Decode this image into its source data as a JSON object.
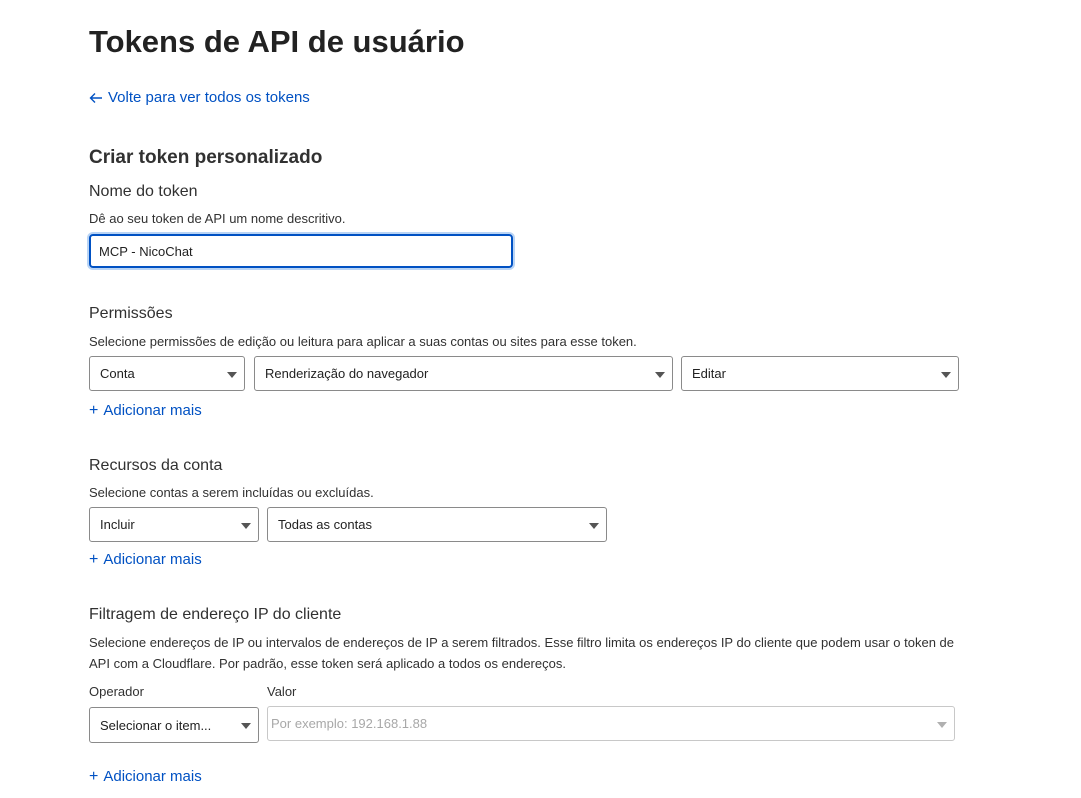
{
  "page": {
    "title": "Tokens de API de usuário",
    "back_link": "Volte para ver todos os tokens",
    "section_title": "Criar token personalizado"
  },
  "token_name": {
    "label": "Nome do token",
    "description": "Dê ao seu token de API um nome descritivo.",
    "value": "MCP - NicoChat"
  },
  "permissions": {
    "label": "Permissões",
    "description": "Selecione permissões de edição ou leitura para aplicar a suas contas ou sites para esse token.",
    "scope_select": "Conta",
    "resource_select": "Renderização do navegador",
    "level_select": "Editar",
    "add_more": "Adicionar mais"
  },
  "account_resources": {
    "label": "Recursos da conta",
    "description": "Selecione contas a serem incluídas ou excluídas.",
    "mode_select": "Incluir",
    "accounts_select": "Todas as contas",
    "add_more": "Adicionar mais"
  },
  "ip_filtering": {
    "label": "Filtragem de endereço IP do cliente",
    "description": "Selecione endereços de IP ou intervalos de endereços de IP a serem filtrados. Esse filtro limita os endereços IP do cliente que podem usar o token de API com a Cloudflare. Por padrão, esse token será aplicado a todos os endereços.",
    "operator_label": "Operador",
    "value_label": "Valor",
    "operator_select": "Selecionar o item...",
    "value_placeholder": "Por exemplo: 192.168.1.88",
    "add_more": "Adicionar mais"
  },
  "colors": {
    "link": "#0051c3",
    "focus_border": "#0051c3",
    "text": "#313131"
  },
  "icons": {
    "back": "arrow-left-icon",
    "add": "plus-icon",
    "dropdown": "caret-down-icon"
  }
}
